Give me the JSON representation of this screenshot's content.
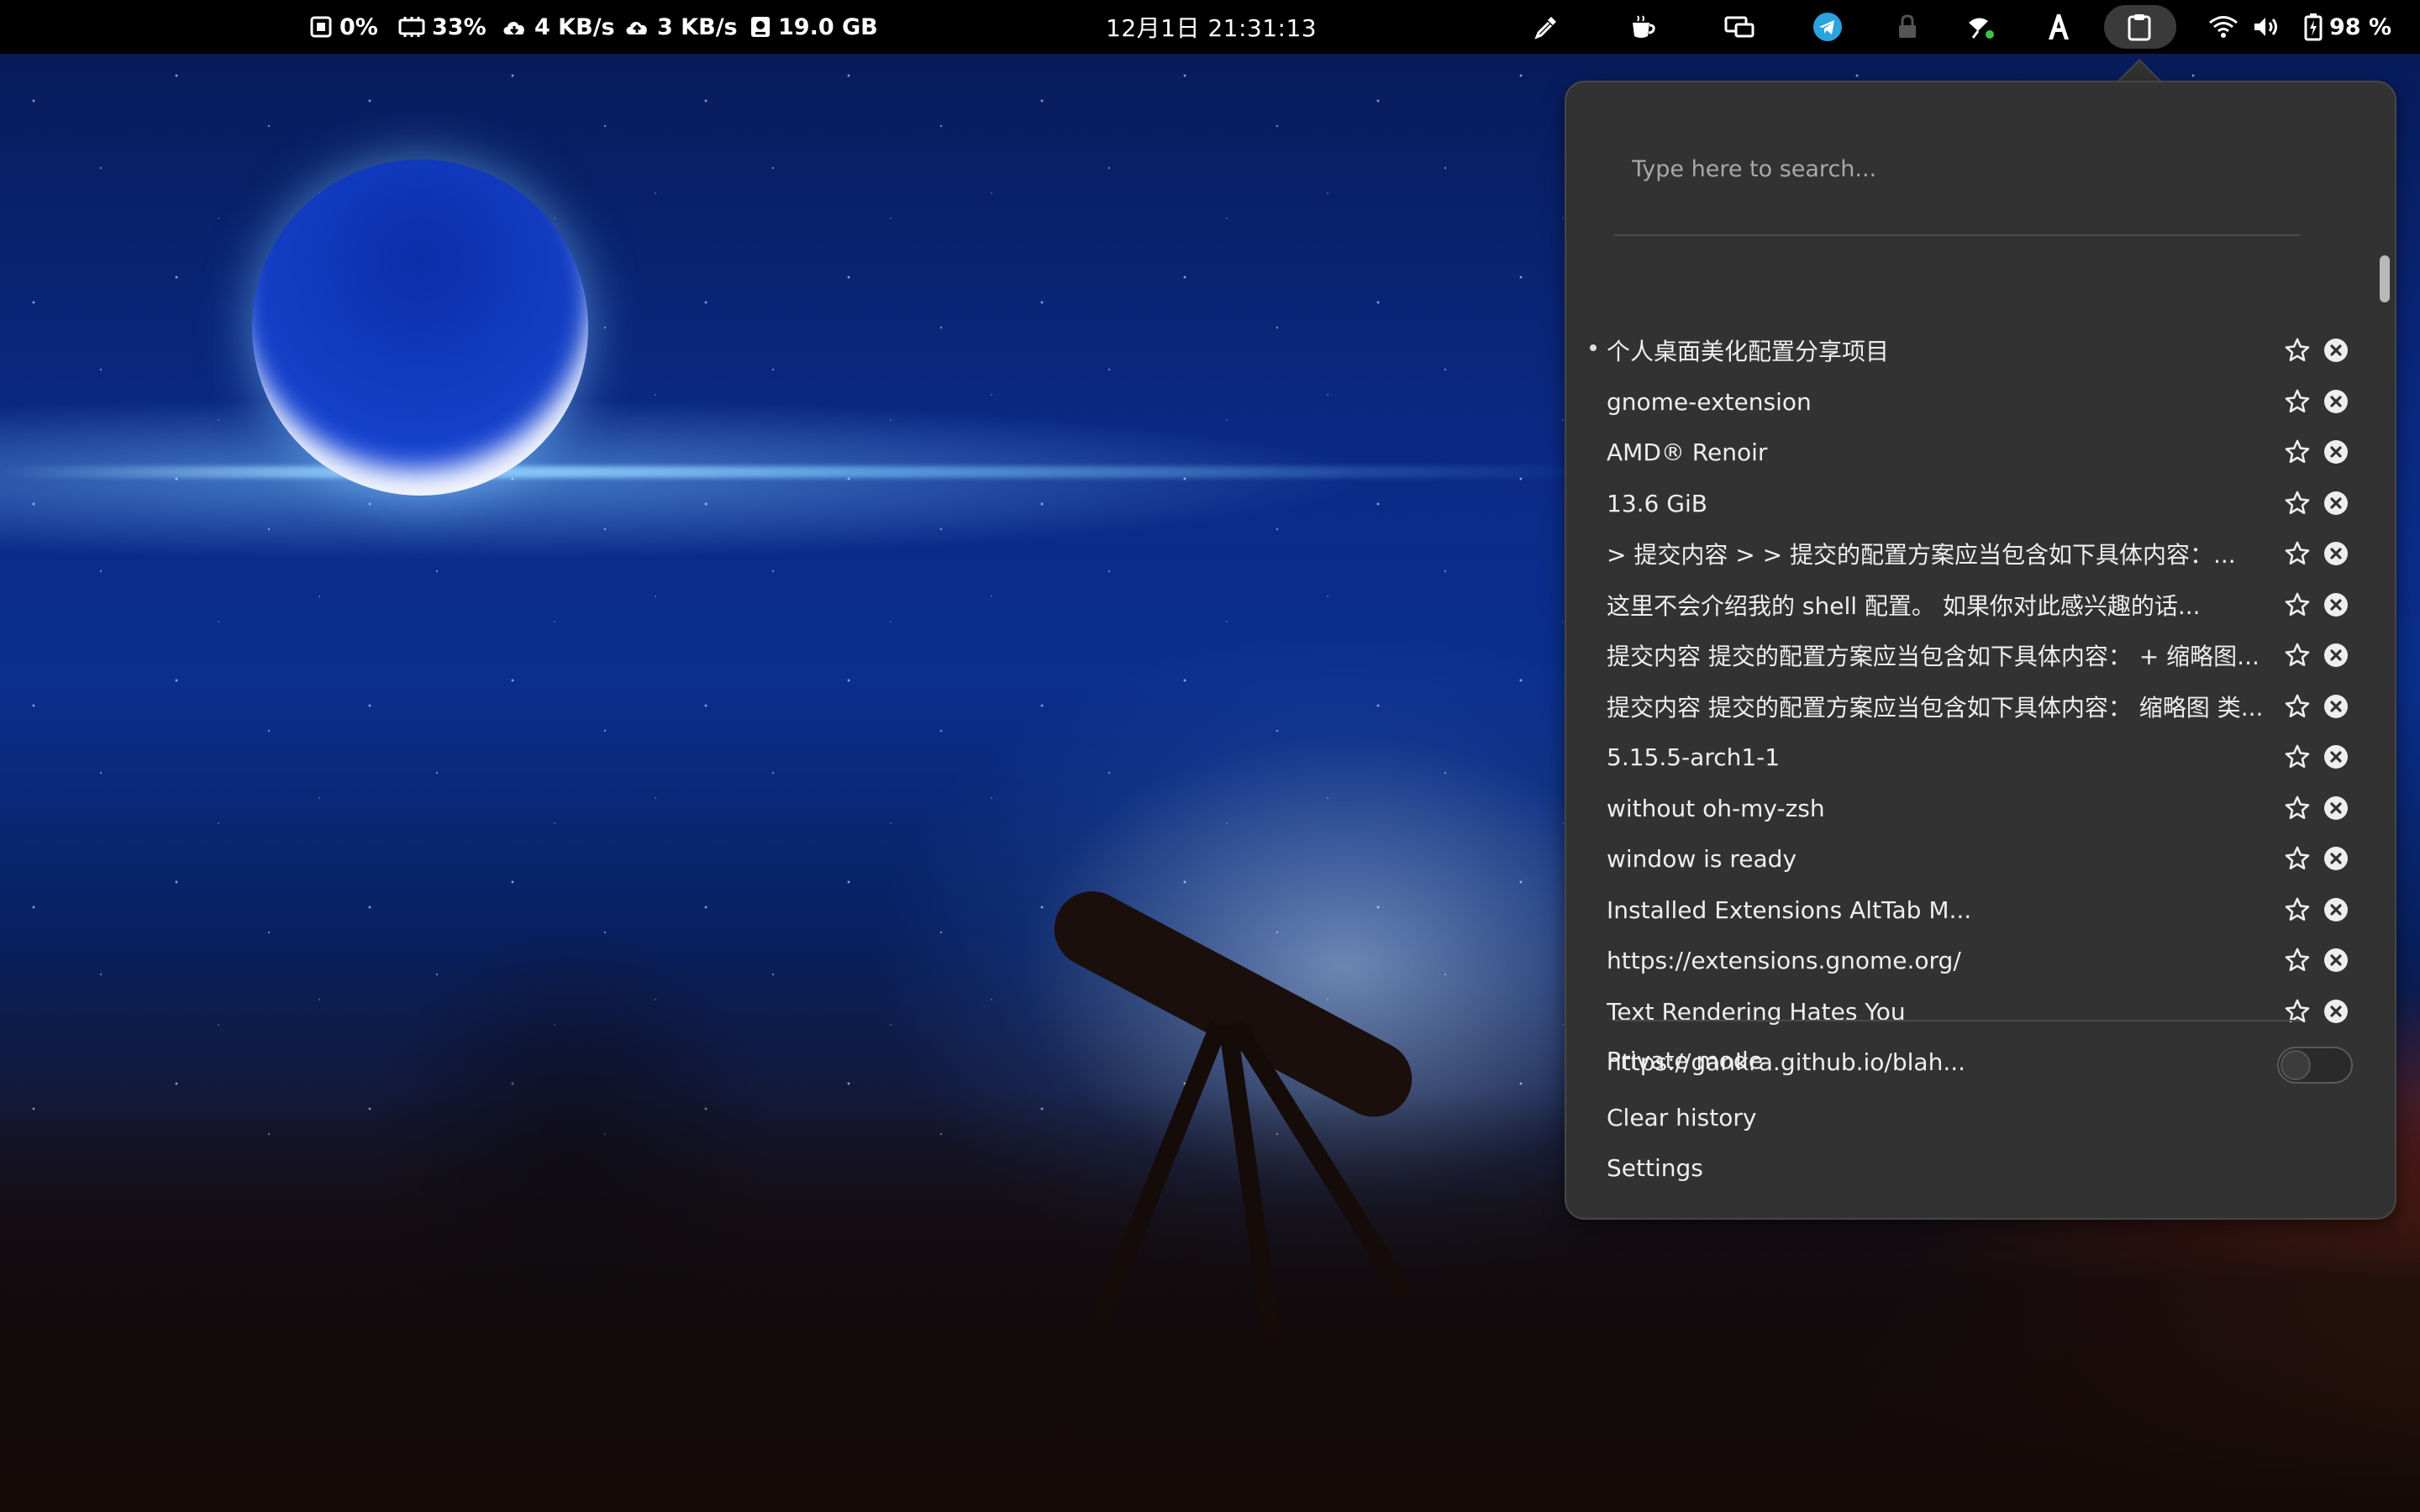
{
  "topbar": {
    "cpu": "0%",
    "memory": "33%",
    "download": "4 KB/s",
    "upload": "3 KB/s",
    "disk": "19.0 GB",
    "clock": "12月1日  21:31:13",
    "battery": "98 %",
    "tray_icons": [
      "color-picker-icon",
      "coffee-icon",
      "screen-icon",
      "telegram-icon",
      "lock-icon",
      "satellite-icon",
      "font-icon",
      "clipboard-icon"
    ],
    "status_icons": [
      "wifi-icon",
      "volume-icon",
      "battery-icon"
    ]
  },
  "clipboard": {
    "search_placeholder": "Type here to search...",
    "entries": [
      {
        "text": "个人桌面美化配置分享项目",
        "active": true
      },
      {
        "text": "gnome-extension"
      },
      {
        "text": "AMD® Renoir"
      },
      {
        "text": "13.6 GiB"
      },
      {
        "text": "> 提交内容 > > 提交的配置方案应当包含如下具体内容：..."
      },
      {
        "text": "这里不会介绍我的 shell 配置。 如果你对此感兴趣的话..."
      },
      {
        "text": "提交内容 提交的配置方案应当包含如下具体内容： + 缩略图..."
      },
      {
        "text": "提交内容 提交的配置方案应当包含如下具体内容： 缩略图 类..."
      },
      {
        "text": "5.15.5-arch1-1"
      },
      {
        "text": "without oh-my-zsh"
      },
      {
        "text": "window is ready"
      },
      {
        "text": "Installed Extensions AltTab M..."
      },
      {
        "text": "https://extensions.gnome.org/"
      },
      {
        "text": "Text Rendering Hates You"
      },
      {
        "text": "https://gankra.github.io/blah..."
      }
    ],
    "private_mode_label": "Private mode",
    "private_mode_on": false,
    "clear_history_label": "Clear history",
    "settings_label": "Settings"
  },
  "colors": {
    "panel_bg": "#323232",
    "topbar_bg": "#000000",
    "text": "#eeeeee",
    "telegram": "#2aa3df"
  }
}
